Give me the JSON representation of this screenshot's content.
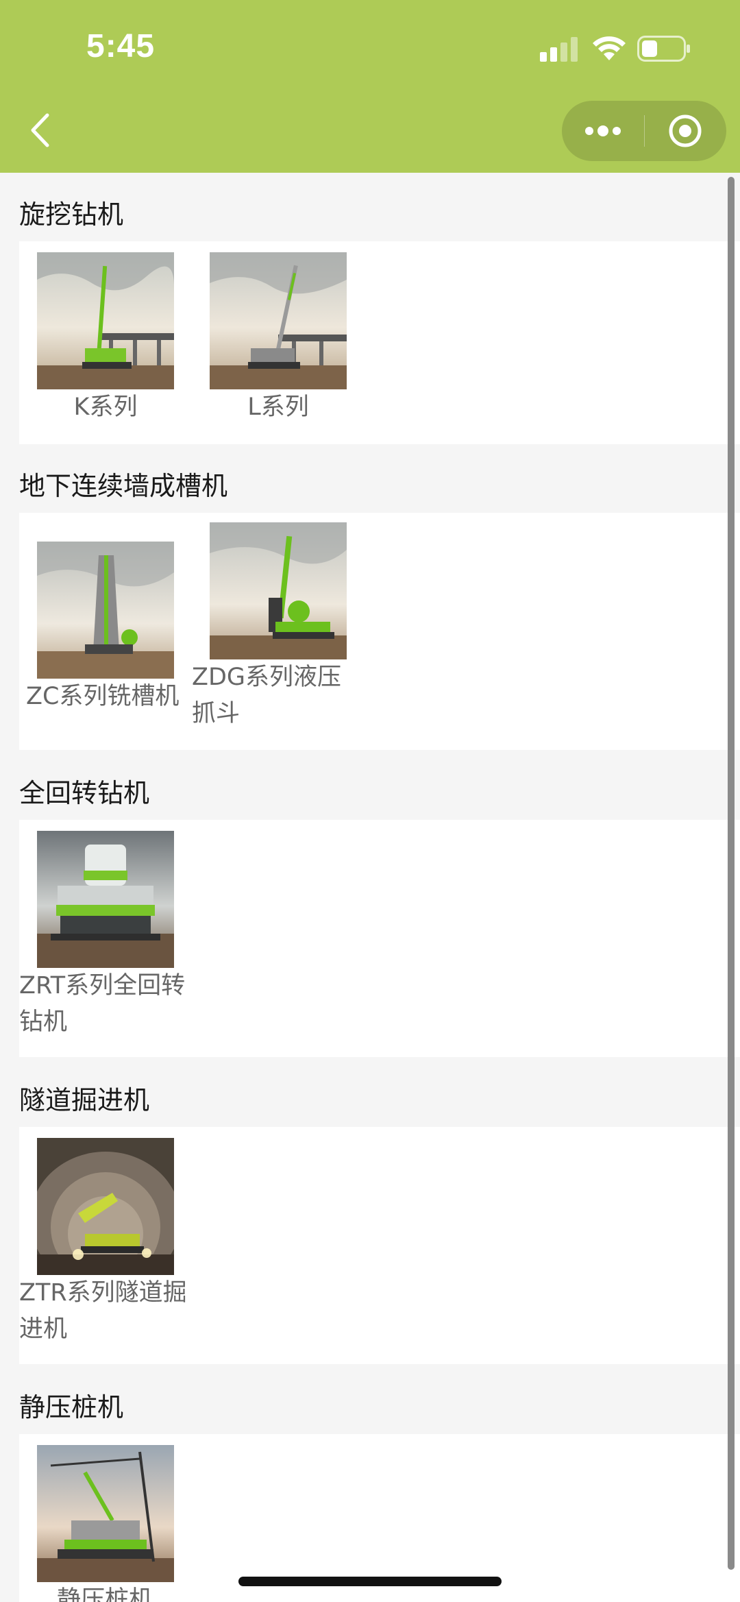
{
  "status_bar": {
    "time": "5:45"
  },
  "sections": [
    {
      "title": "旋挖钻机",
      "items": [
        {
          "label": "K系列"
        },
        {
          "label": "L系列"
        }
      ]
    },
    {
      "title": "地下连续墙成槽机",
      "items": [
        {
          "label": "ZC系列铣槽机"
        },
        {
          "label": "ZDG系列液压抓斗"
        }
      ]
    },
    {
      "title": "全回转钻机",
      "items": [
        {
          "label": "ZRT系列全回转钻机"
        }
      ]
    },
    {
      "title": "隧道掘进机",
      "items": [
        {
          "label": "ZTR系列隧道掘进机"
        }
      ]
    },
    {
      "title": "静压桩机",
      "items": [
        {
          "label": "静压桩机"
        }
      ]
    }
  ],
  "colors": {
    "brand": "#aecb56",
    "accent": "#8fd12a"
  }
}
